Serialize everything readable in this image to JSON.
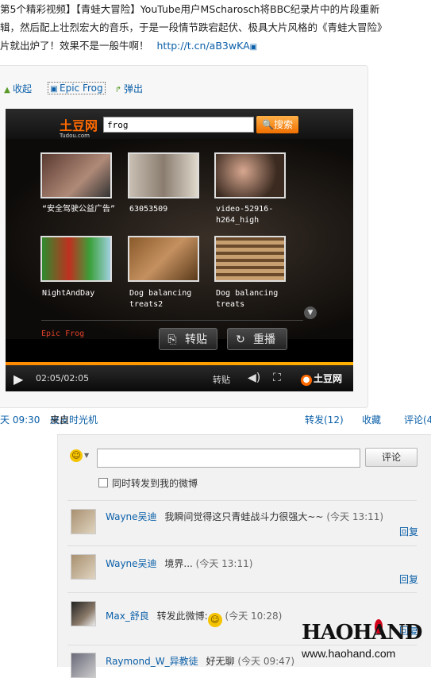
{
  "post": {
    "line1": "第5个精彩视频】【青蛙大冒险】YouTube用户MScharosch将BBC纪录片中的片段重新",
    "line2": "辑，然后配上壮烈宏大的音乐，于是一段情节跌宕起伏、极具大片风格的《青蛙大冒险》",
    "line3": "片就出炉了！效果不是一般牛啊！",
    "link": "http://t.cn/aB3wKA"
  },
  "toolbar": {
    "collapse": "收起",
    "title": "Epic Frog",
    "popout": "弹出"
  },
  "player": {
    "brand": "土豆网",
    "brand_sub": "Tudou.com",
    "search_value": "frog",
    "search_button": "搜索",
    "results": [
      {
        "caption": "“安全驾驶公益广告”"
      },
      {
        "caption": "63053509"
      },
      {
        "caption": "video-52916-h264_high"
      },
      {
        "caption": "NightAndDay"
      },
      {
        "caption": "Dog balancing treats2"
      },
      {
        "caption": "Dog balancing treats"
      }
    ],
    "video_title": "Epic Frog",
    "repost_button": "转贴",
    "replay_button": "重播",
    "time": "02:05/02:05",
    "share": "转贴",
    "progress": 1.0,
    "footer_brand": "土豆网"
  },
  "meta": {
    "time": "天  09:30",
    "source_prefix": "来自",
    "source": "皮皮时光机",
    "repost": "转发(12)",
    "favorite": "收藏",
    "comment": "评论(4"
  },
  "compose": {
    "submit": "评论",
    "repost_label": "同时转发到我的微博"
  },
  "comments": [
    {
      "user": "Wayne吴迪",
      "text": "我瞬间觉得这只青蛙战斗力很强大~~",
      "time": "(今天  13:11)",
      "reply": "回复"
    },
    {
      "user": "Wayne吴迪",
      "text": "境界...",
      "time": "(今天  13:11)",
      "reply": "回复"
    },
    {
      "user": "Max_舒良",
      "text": "转发此微博:",
      "time": "(今天  10:28)",
      "reply": "回复"
    },
    {
      "user": "Raymond_W_异教徒",
      "text": "好无聊",
      "time": "(今天  09:47)",
      "reply": ""
    }
  ],
  "watermark": {
    "name": "HAOHAND",
    "url": "www.haohand.com"
  },
  "colors": {
    "link": "#0a5fa8",
    "accent": "#ff6a00",
    "title_red": "#e0402a"
  }
}
